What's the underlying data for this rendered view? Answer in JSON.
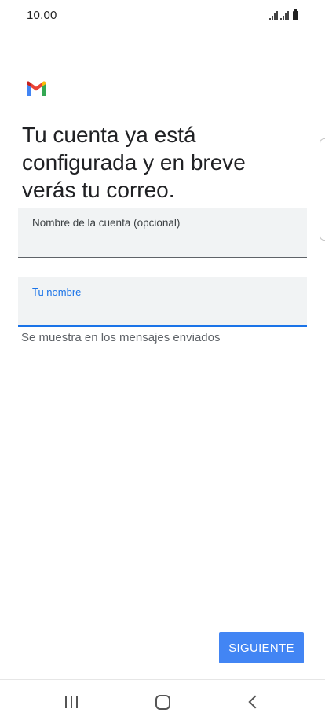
{
  "status_bar": {
    "time": "10.00",
    "icons": [
      "signal-icon",
      "signal-icon",
      "battery-icon"
    ]
  },
  "app": {
    "logo": "gmail-logo-icon",
    "brand_colors": {
      "blue": "#4285F4",
      "red": "#EA4335",
      "yellow": "#FBBC04",
      "green": "#34A853"
    }
  },
  "main": {
    "title": "Tu cuenta ya está configurada y en breve verás tu correo.",
    "account_name_field": {
      "label": "Nombre de la cuenta (opcional)",
      "value": ""
    },
    "your_name_field": {
      "label": "Tu nombre",
      "value": ""
    },
    "helper_text": "Se muestra en los mensajes enviados",
    "next_button_label": "SIGUIENTE",
    "accent_color": "#1A73E8"
  },
  "nav_bar": {
    "recents_icon": "recents-icon",
    "home_icon": "home-icon",
    "back_icon": "back-icon"
  }
}
